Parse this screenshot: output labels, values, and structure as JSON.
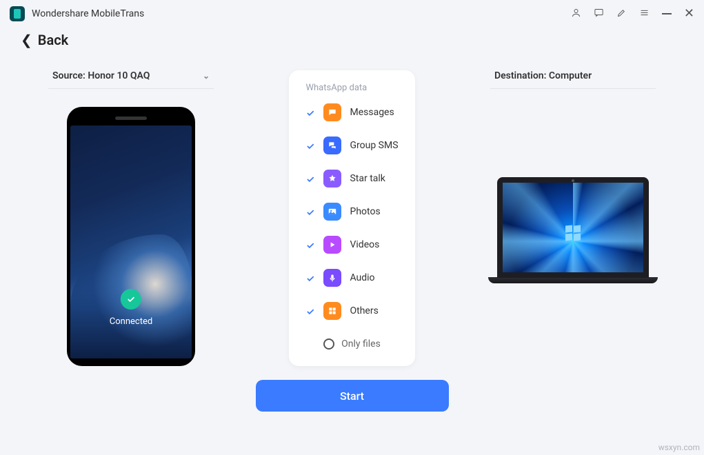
{
  "app": {
    "title": "Wondershare MobileTrans"
  },
  "nav": {
    "back": "Back"
  },
  "source": {
    "label": "Source: Honor 10 QAQ",
    "status": "Connected"
  },
  "destination": {
    "label": "Destination: Computer"
  },
  "card": {
    "title": "WhatsApp data",
    "items": [
      {
        "label": "Messages",
        "color": "#ff8b1f",
        "checked": true
      },
      {
        "label": "Group SMS",
        "color": "#3a6bff",
        "checked": true
      },
      {
        "label": "Star talk",
        "color": "#8a5cff",
        "checked": true
      },
      {
        "label": "Photos",
        "color": "#3a8bff",
        "checked": true
      },
      {
        "label": "Videos",
        "color": "#b84bff",
        "checked": true
      },
      {
        "label": "Audio",
        "color": "#7a4bff",
        "checked": true
      },
      {
        "label": "Others",
        "color": "#ff8b1f",
        "checked": true
      }
    ],
    "only_files": "Only files"
  },
  "actions": {
    "start": "Start"
  },
  "watermark": "wsxyn.com"
}
